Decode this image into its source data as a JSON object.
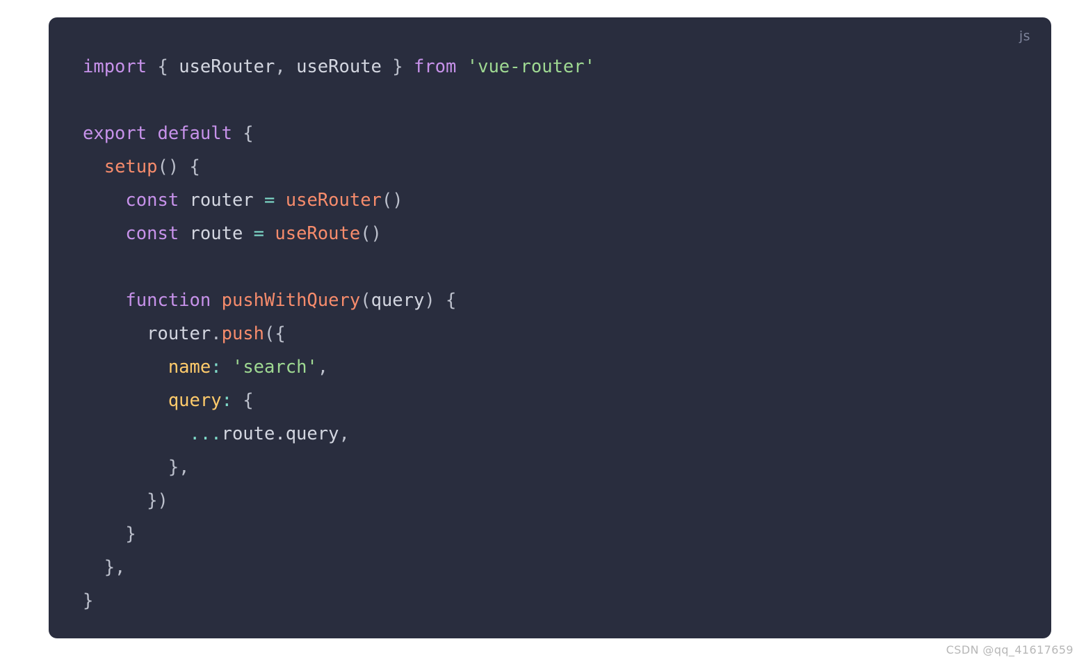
{
  "code_block": {
    "language_label": "js",
    "background_color": "#292d3e",
    "lines": [
      {
        "id": "line-1",
        "tokens": [
          {
            "text": "import",
            "type": "keyword"
          },
          {
            "text": " { ",
            "type": "punctuation"
          },
          {
            "text": "useRouter",
            "type": "plain"
          },
          {
            "text": ", ",
            "type": "punctuation"
          },
          {
            "text": "useRoute",
            "type": "plain"
          },
          {
            "text": " } ",
            "type": "punctuation"
          },
          {
            "text": "from",
            "type": "keyword"
          },
          {
            "text": " ",
            "type": "plain"
          },
          {
            "text": "'vue-router'",
            "type": "string"
          }
        ]
      },
      {
        "id": "line-2",
        "tokens": []
      },
      {
        "id": "line-3",
        "tokens": [
          {
            "text": "export default",
            "type": "keyword"
          },
          {
            "text": " {",
            "type": "punctuation"
          }
        ]
      },
      {
        "id": "line-4",
        "tokens": [
          {
            "text": "  ",
            "type": "plain"
          },
          {
            "text": "setup",
            "type": "function"
          },
          {
            "text": "() {",
            "type": "punctuation"
          }
        ]
      },
      {
        "id": "line-5",
        "tokens": [
          {
            "text": "    ",
            "type": "plain"
          },
          {
            "text": "const",
            "type": "keyword"
          },
          {
            "text": " router ",
            "type": "plain"
          },
          {
            "text": "=",
            "type": "operator"
          },
          {
            "text": " ",
            "type": "plain"
          },
          {
            "text": "useRouter",
            "type": "function"
          },
          {
            "text": "()",
            "type": "punctuation"
          }
        ]
      },
      {
        "id": "line-6",
        "tokens": [
          {
            "text": "    ",
            "type": "plain"
          },
          {
            "text": "const",
            "type": "keyword"
          },
          {
            "text": " route ",
            "type": "plain"
          },
          {
            "text": "=",
            "type": "operator"
          },
          {
            "text": " ",
            "type": "plain"
          },
          {
            "text": "useRoute",
            "type": "function"
          },
          {
            "text": "()",
            "type": "punctuation"
          }
        ]
      },
      {
        "id": "line-7",
        "tokens": []
      },
      {
        "id": "line-8",
        "tokens": [
          {
            "text": "    ",
            "type": "plain"
          },
          {
            "text": "function",
            "type": "keyword"
          },
          {
            "text": " ",
            "type": "plain"
          },
          {
            "text": "pushWithQuery",
            "type": "function"
          },
          {
            "text": "(",
            "type": "punctuation"
          },
          {
            "text": "query",
            "type": "plain"
          },
          {
            "text": ") {",
            "type": "punctuation"
          }
        ]
      },
      {
        "id": "line-9",
        "tokens": [
          {
            "text": "      router",
            "type": "plain"
          },
          {
            "text": ".",
            "type": "punctuation"
          },
          {
            "text": "push",
            "type": "function"
          },
          {
            "text": "({",
            "type": "punctuation"
          }
        ]
      },
      {
        "id": "line-10",
        "tokens": [
          {
            "text": "        ",
            "type": "plain"
          },
          {
            "text": "name",
            "type": "property"
          },
          {
            "text": ":",
            "type": "operator"
          },
          {
            "text": " ",
            "type": "plain"
          },
          {
            "text": "'search'",
            "type": "string"
          },
          {
            "text": ",",
            "type": "punctuation"
          }
        ]
      },
      {
        "id": "line-11",
        "tokens": [
          {
            "text": "        ",
            "type": "plain"
          },
          {
            "text": "query",
            "type": "property"
          },
          {
            "text": ":",
            "type": "operator"
          },
          {
            "text": " {",
            "type": "punctuation"
          }
        ]
      },
      {
        "id": "line-12",
        "tokens": [
          {
            "text": "          ",
            "type": "plain"
          },
          {
            "text": "...",
            "type": "operator"
          },
          {
            "text": "route.query",
            "type": "plain"
          },
          {
            "text": ",",
            "type": "punctuation"
          }
        ]
      },
      {
        "id": "line-13",
        "tokens": [
          {
            "text": "        },",
            "type": "punctuation"
          }
        ]
      },
      {
        "id": "line-14",
        "tokens": [
          {
            "text": "      })",
            "type": "punctuation"
          }
        ]
      },
      {
        "id": "line-15",
        "tokens": [
          {
            "text": "    }",
            "type": "punctuation"
          }
        ]
      },
      {
        "id": "line-16",
        "tokens": [
          {
            "text": "  },",
            "type": "punctuation"
          }
        ]
      },
      {
        "id": "line-17",
        "tokens": [
          {
            "text": "}",
            "type": "punctuation"
          }
        ]
      }
    ]
  },
  "watermark": {
    "text": "CSDN @qq_41617659"
  },
  "colors": {
    "page_background": "#ffffff",
    "code_background": "#292d3e",
    "keyword": "#c792ea",
    "function": "#f78c6c",
    "string": "#9fd992",
    "property": "#ffcb6b",
    "operator": "#7fdbca",
    "plain": "#d3d6e0",
    "punctuation": "#bcc0cc",
    "language_label": "#7e849b",
    "watermark": "#b7b7b7"
  }
}
